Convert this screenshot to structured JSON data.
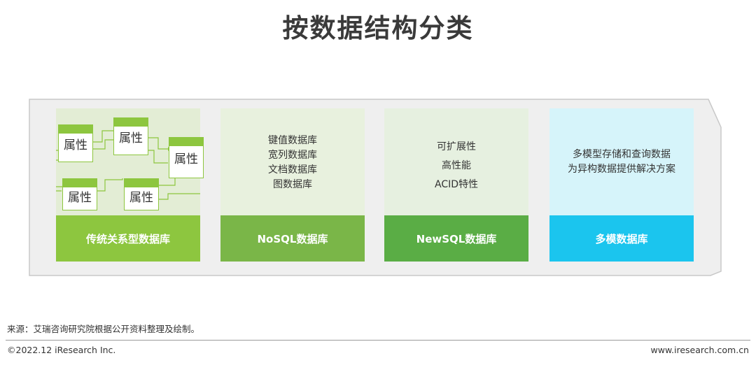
{
  "title": "按数据结构分类",
  "colors": {
    "panel": "#efefef",
    "panel_border": "#c8c8c8",
    "relational_top": "#e3edd5",
    "relational_label": "#8dc63f",
    "nosql_top": "#e8f1de",
    "nosql_label": "#7ab648",
    "newsql_top": "#e6f0e0",
    "newsql_label": "#5aad45",
    "multimodel_top": "#d6f4fa",
    "multimodel_label": "#1bc5ee"
  },
  "cards": {
    "relational": {
      "label": "传统关系型数据库",
      "entities": [
        "属性",
        "属性",
        "属性",
        "属性",
        "属性"
      ]
    },
    "nosql": {
      "label": "NoSQL数据库",
      "lines": [
        "键值数据库",
        "宽列数据库",
        "文档数据库",
        "图数据库"
      ]
    },
    "newsql": {
      "label": "NewSQL数据库",
      "lines": [
        "可扩展性",
        "高性能",
        "ACID特性"
      ]
    },
    "multimodel": {
      "label": "多模数据库",
      "lines": [
        "多模型存储和查询数据",
        "为异构数据提供解决方案"
      ]
    }
  },
  "footer": {
    "source": "来源：艾瑞咨询研究院根据公开资料整理及绘制。",
    "copyright": "©2022.12 iResearch Inc.",
    "website": "www.iresearch.com.cn"
  }
}
